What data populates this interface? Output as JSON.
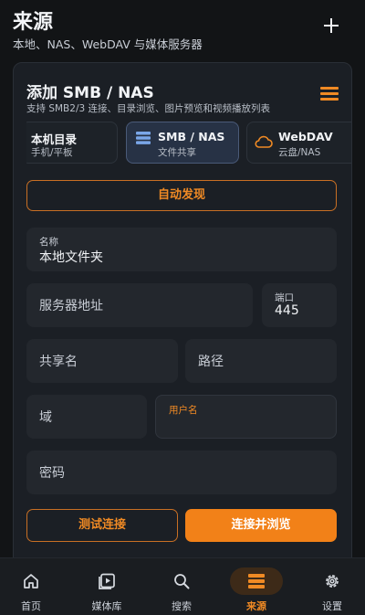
{
  "header": {
    "title": "来源",
    "subtitle": "本地、NAS、WebDAV 与媒体服务器"
  },
  "card": {
    "title": "添加 SMB / NAS",
    "description": "支持 SMB2/3 连接、目录浏览、图片预览和视频播放列表",
    "source_types": [
      {
        "label": "本机目录",
        "sub": "手机/平板"
      },
      {
        "label": "SMB / NAS",
        "sub": "文件共享",
        "selected": true
      },
      {
        "label": "WebDAV",
        "sub": "云盘/NAS"
      }
    ],
    "discover_label": "自动发现",
    "fields": {
      "name": {
        "label": "名称",
        "value": "本地文件夹"
      },
      "server": {
        "placeholder": "服务器地址"
      },
      "port": {
        "label": "端口",
        "value": "445"
      },
      "share": {
        "placeholder": "共享名"
      },
      "path": {
        "placeholder": "路径"
      },
      "domain": {
        "placeholder": "域"
      },
      "username": {
        "label": "用户名"
      },
      "password": {
        "placeholder": "密码"
      }
    },
    "test_label": "测试连接",
    "connect_label": "连接并浏览"
  },
  "nav": {
    "items": [
      {
        "label": "首页",
        "icon": "home-icon"
      },
      {
        "label": "媒体库",
        "icon": "library-icon"
      },
      {
        "label": "搜索",
        "icon": "search-icon"
      },
      {
        "label": "来源",
        "icon": "sources-icon",
        "active": true
      },
      {
        "label": "设置",
        "icon": "gear-icon"
      }
    ]
  },
  "colors": {
    "accent": "#f28118",
    "background": "#121416",
    "card": "#1b1f25",
    "field": "#23272d",
    "selected_type": "#273245"
  }
}
